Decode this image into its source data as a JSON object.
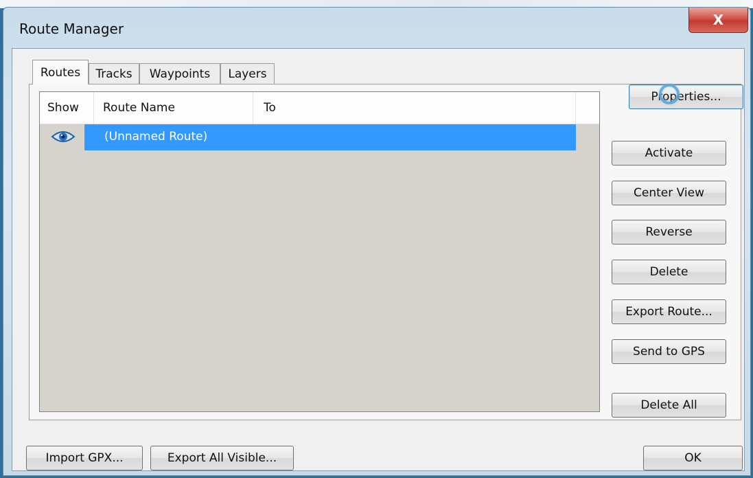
{
  "window": {
    "title": "Route Manager",
    "close_glyph": "X"
  },
  "tabs": [
    {
      "label": "Routes",
      "active": true
    },
    {
      "label": "Tracks",
      "active": false
    },
    {
      "label": "Waypoints",
      "active": false
    },
    {
      "label": "Layers",
      "active": false
    }
  ],
  "list": {
    "columns": [
      "Show",
      "Route Name",
      "To"
    ],
    "rows": [
      {
        "show": "eye-icon",
        "route_name": "(Unnamed Route)",
        "to": "",
        "selected": true
      }
    ]
  },
  "side_buttons": {
    "properties": "Properties...",
    "activate": "Activate",
    "center_view": "Center View",
    "reverse": "Reverse",
    "delete": "Delete",
    "export_route": "Export Route...",
    "send_to_gps": "Send to GPS",
    "delete_all": "Delete All"
  },
  "bottom_buttons": {
    "import_gpx": "Import GPX...",
    "export_all_visible": "Export All Visible...",
    "ok": "OK"
  },
  "colors": {
    "selection": "#3399ff",
    "list_background": "#d6d2cc",
    "close_button": "#c8463d"
  }
}
